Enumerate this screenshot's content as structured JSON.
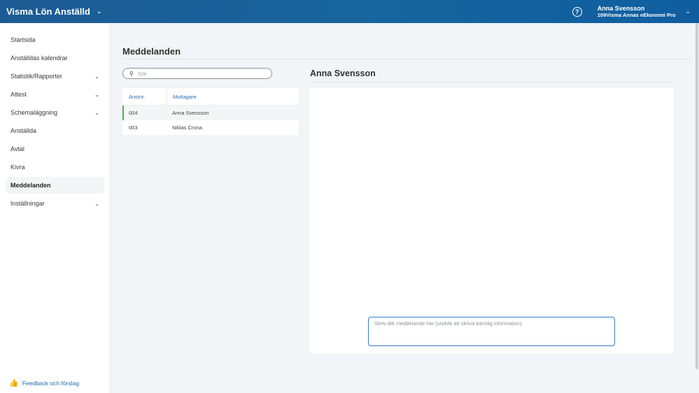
{
  "header": {
    "app_title": "Visma Lön Anställd",
    "help_label": "?",
    "user_name": "Anna Svensson",
    "user_org": "109Visma Annas eEkonomi Pro"
  },
  "sidebar": {
    "items": [
      {
        "label": "Startsida"
      },
      {
        "label": "Anställdas kalendrar"
      },
      {
        "label": "Statistik/Rapporter"
      },
      {
        "label": "Attest"
      },
      {
        "label": "Schemaläggning"
      },
      {
        "label": "Anställda"
      },
      {
        "label": "Avtal"
      },
      {
        "label": "Kivra"
      },
      {
        "label": "Meddelanden"
      },
      {
        "label": "Inställningar"
      }
    ],
    "feedback_label": "Feedback och förslag"
  },
  "main": {
    "page_title": "Meddelanden",
    "search_placeholder": "Sök",
    "list": {
      "columns": [
        "Anstnr.",
        "Mottagare"
      ],
      "rows": [
        {
          "id": "004",
          "name": "Anna Svensson"
        },
        {
          "id": "003",
          "name": "Niklas Crona"
        }
      ]
    },
    "conversation": {
      "title": "Anna Svensson",
      "input_placeholder": "Skriv ditt meddelande här (undvik att skriva känslig information)."
    }
  },
  "colors": {
    "header_bg": "#17659e",
    "link": "#2f6fad",
    "selected_marker": "#4caf50",
    "input_border": "#2f7ad0"
  }
}
